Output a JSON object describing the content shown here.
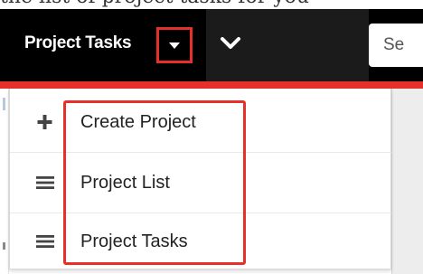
{
  "page_text_fragment": "the list of project tasks for you",
  "navbar": {
    "module_title": "Project Tasks",
    "module_menu_icon": "caret-down-icon",
    "more_icon": "chevron-down-icon",
    "search_placeholder": "Se"
  },
  "menu": {
    "items": [
      {
        "icon": "plus-icon",
        "label": "Create Project"
      },
      {
        "icon": "hamburger-icon",
        "label": "Project List"
      },
      {
        "icon": "hamburger-icon",
        "label": "Project Tasks"
      }
    ]
  },
  "colors": {
    "navbar_bg": "#000000",
    "accent_red": "#e8302a",
    "menu_text": "#222222",
    "icon_gray": "#444444"
  }
}
